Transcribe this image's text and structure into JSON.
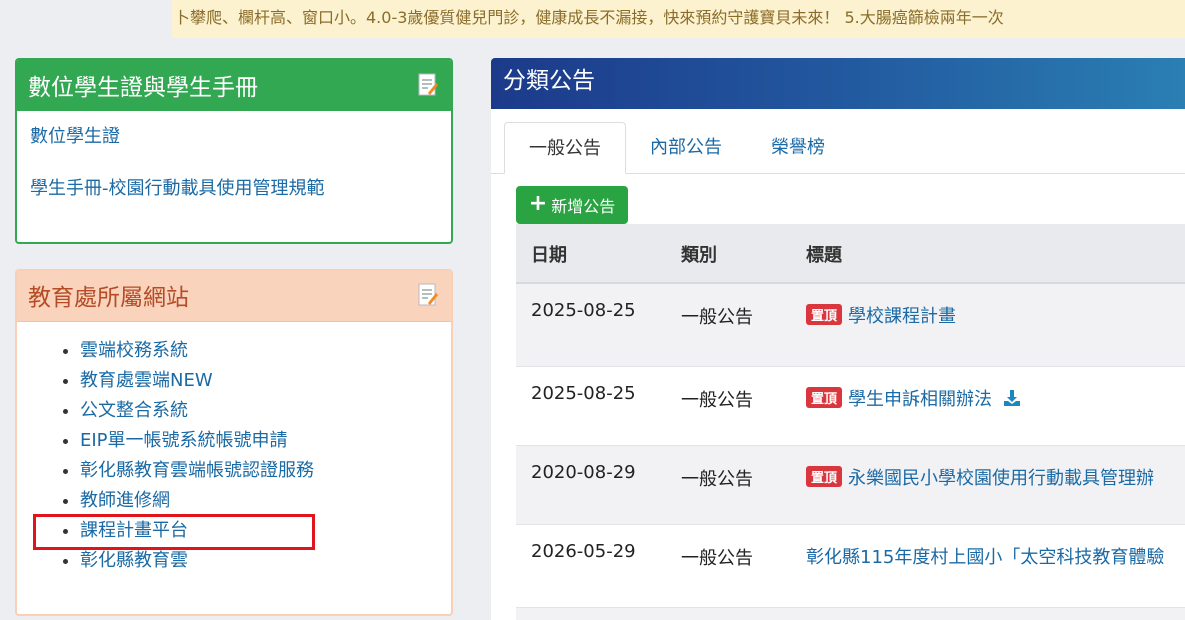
{
  "marquee": "卜攀爬、欄杆高、窗口小。4.0-3歲優質健兒門診，健康成長不漏接，快來預約守護寶貝未來！ 5.大腸癌篩檢兩年一次",
  "student_card": {
    "title": "數位學生證與學生手冊",
    "links": [
      "數位學生證",
      "學生手冊-校園行動載具使用管理規範"
    ]
  },
  "edu_sites": {
    "title": "教育處所屬網站",
    "links": [
      "雲端校務系統",
      "教育處雲端NEW",
      "公文整合系統",
      "EIP單一帳號系統帳號申請",
      "彰化縣教育雲端帳號認證服務",
      "教師進修網",
      "課程計畫平台",
      "彰化縣教育雲"
    ]
  },
  "announcements": {
    "title": "分類公告",
    "tabs": [
      "一般公告",
      "內部公告",
      "榮譽榜"
    ],
    "add_button": "新增公告",
    "columns": [
      "日期",
      "類別",
      "標題"
    ],
    "pin_label": "置頂",
    "rows": [
      {
        "date": "2025-08-25",
        "category": "一般公告",
        "title": "學校課程計畫"
      },
      {
        "date": "2025-08-25",
        "category": "一般公告",
        "title": "學生申訴相關辦法"
      },
      {
        "date": "2020-08-29",
        "category": "一般公告",
        "title": "永樂國民小學校園使用行動載具管理辦"
      },
      {
        "date": "2026-05-29",
        "category": "一般公告",
        "title": "彰化縣115年度村上國小「太空科技教育體驗"
      }
    ]
  },
  "colors": {
    "green": "#33a853",
    "orange_header": "#fad3bd",
    "link": "#1b6aa5",
    "pin": "#d9363e",
    "highlight_box": "#e0141b"
  }
}
